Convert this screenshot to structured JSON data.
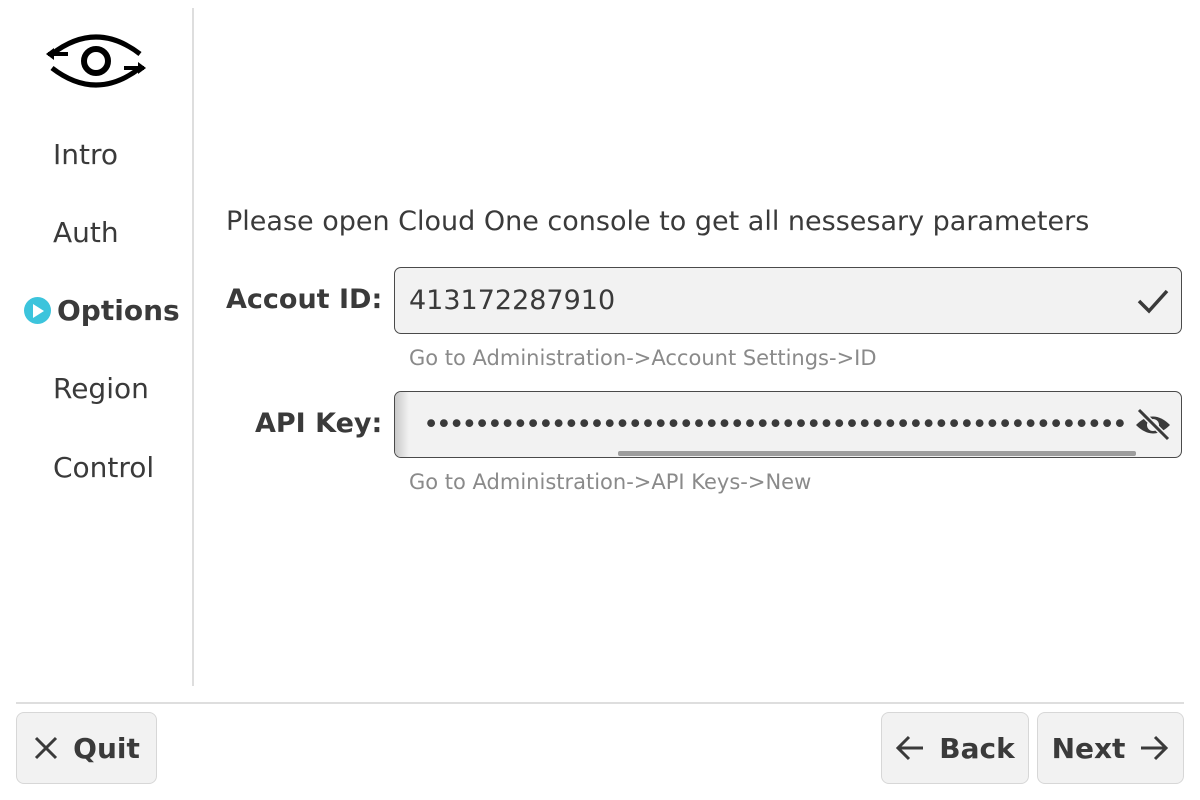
{
  "sidebar": {
    "logo": "eye-arrows-logo",
    "items": [
      {
        "label": "Intro",
        "active": false
      },
      {
        "label": "Auth",
        "active": false
      },
      {
        "label": "Options",
        "active": true
      },
      {
        "label": "Region",
        "active": false
      },
      {
        "label": "Control",
        "active": false
      }
    ]
  },
  "main": {
    "instructions": "Please open Cloud One console to get all nessesary parameters",
    "account_id": {
      "label": "Accout ID:",
      "value": "413172287910",
      "hint": "Go to Administration->Account Settings->ID",
      "status_icon": "check-icon"
    },
    "api_key": {
      "label": "API Key:",
      "masked_value": "•••••••••••••••••••••••••••••••••••••••••••••••••••••••••••••••••••••",
      "hint": "Go to Administration->API Keys->New",
      "toggle_icon": "eye-slash-icon"
    }
  },
  "footer": {
    "quit_label": "Quit",
    "back_label": "Back",
    "next_label": "Next"
  },
  "colors": {
    "accent": "#3cc4dc",
    "field_bg": "#f2f2f2",
    "text": "#3a3a3a",
    "hint": "#8a8a8a"
  }
}
